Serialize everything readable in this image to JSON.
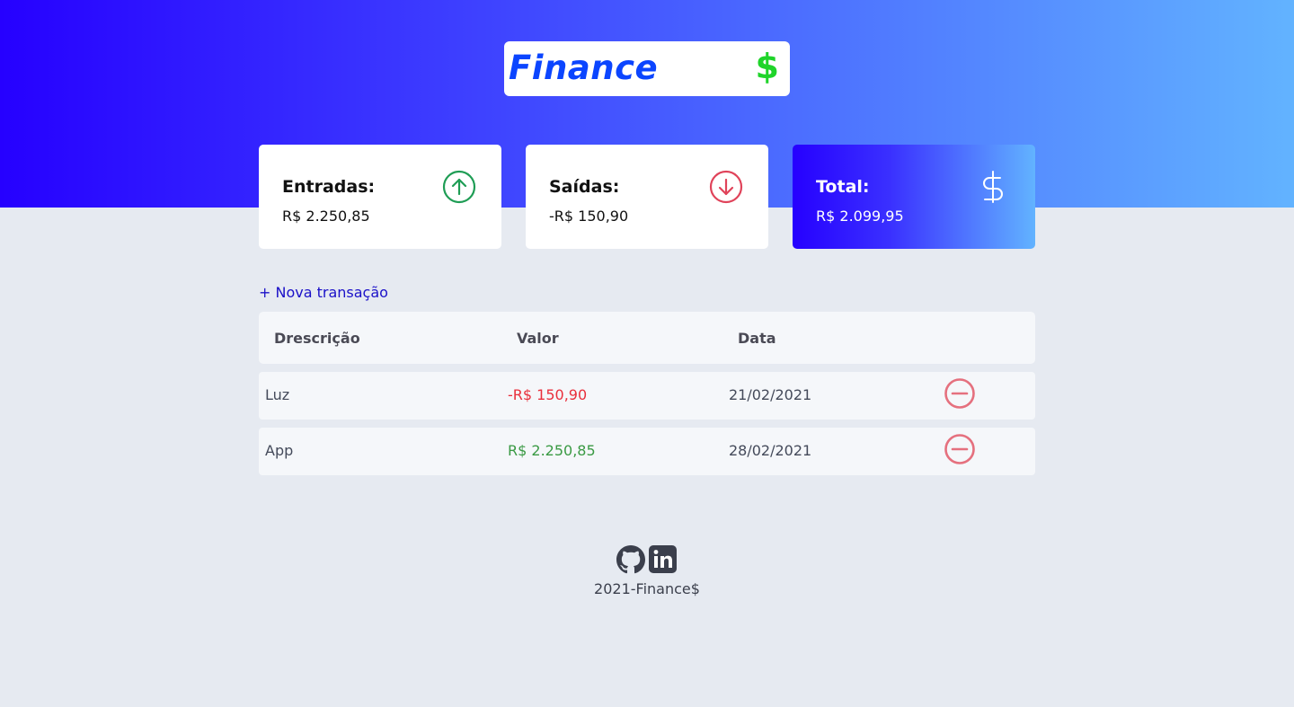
{
  "logo": {
    "text": "Finance",
    "symbol": "$"
  },
  "cards": {
    "income": {
      "title": "Entradas:",
      "value": "R$ 2.250,85",
      "icon": "arrow-up-circle-icon"
    },
    "expense": {
      "title": "Saídas:",
      "value": "-R$ 150,90",
      "icon": "arrow-down-circle-icon"
    },
    "total": {
      "title": "Total:",
      "value": "R$ 2.099,95",
      "icon": "dollar-sign-icon"
    }
  },
  "new_transaction_label": "+ Nova transação",
  "table": {
    "headers": {
      "description": "Drescrição",
      "amount": "Valor",
      "date": "Data"
    },
    "rows": [
      {
        "description": "Luz",
        "amount": "-R$ 150,90",
        "date": "21/02/2021",
        "type": "expense"
      },
      {
        "description": "App",
        "amount": "R$ 2.250,85",
        "date": "28/02/2021",
        "type": "income"
      }
    ]
  },
  "footer": {
    "text": "2021-Finance$",
    "icons": [
      "github-icon",
      "linkedin-icon"
    ]
  },
  "colors": {
    "brand_blue": "#2600ff",
    "gradient_end": "#62b3ff",
    "income_green": "#3a9a44",
    "expense_red": "#e92f3c",
    "background": "#e6eaf1"
  }
}
